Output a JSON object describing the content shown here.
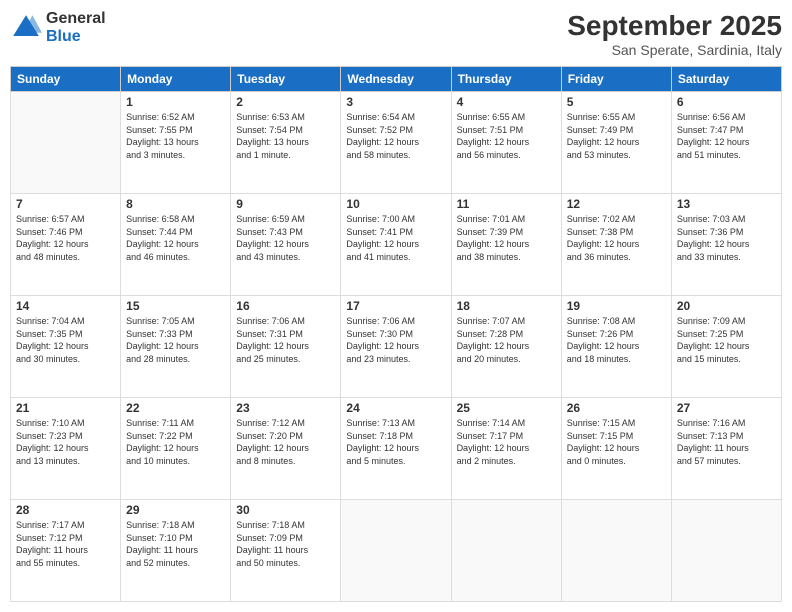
{
  "header": {
    "logo_general": "General",
    "logo_blue": "Blue",
    "month_title": "September 2025",
    "location": "San Sperate, Sardinia, Italy"
  },
  "days_of_week": [
    "Sunday",
    "Monday",
    "Tuesday",
    "Wednesday",
    "Thursday",
    "Friday",
    "Saturday"
  ],
  "weeks": [
    [
      {
        "day": "",
        "info": ""
      },
      {
        "day": "1",
        "info": "Sunrise: 6:52 AM\nSunset: 7:55 PM\nDaylight: 13 hours\nand 3 minutes."
      },
      {
        "day": "2",
        "info": "Sunrise: 6:53 AM\nSunset: 7:54 PM\nDaylight: 13 hours\nand 1 minute."
      },
      {
        "day": "3",
        "info": "Sunrise: 6:54 AM\nSunset: 7:52 PM\nDaylight: 12 hours\nand 58 minutes."
      },
      {
        "day": "4",
        "info": "Sunrise: 6:55 AM\nSunset: 7:51 PM\nDaylight: 12 hours\nand 56 minutes."
      },
      {
        "day": "5",
        "info": "Sunrise: 6:55 AM\nSunset: 7:49 PM\nDaylight: 12 hours\nand 53 minutes."
      },
      {
        "day": "6",
        "info": "Sunrise: 6:56 AM\nSunset: 7:47 PM\nDaylight: 12 hours\nand 51 minutes."
      }
    ],
    [
      {
        "day": "7",
        "info": "Sunrise: 6:57 AM\nSunset: 7:46 PM\nDaylight: 12 hours\nand 48 minutes."
      },
      {
        "day": "8",
        "info": "Sunrise: 6:58 AM\nSunset: 7:44 PM\nDaylight: 12 hours\nand 46 minutes."
      },
      {
        "day": "9",
        "info": "Sunrise: 6:59 AM\nSunset: 7:43 PM\nDaylight: 12 hours\nand 43 minutes."
      },
      {
        "day": "10",
        "info": "Sunrise: 7:00 AM\nSunset: 7:41 PM\nDaylight: 12 hours\nand 41 minutes."
      },
      {
        "day": "11",
        "info": "Sunrise: 7:01 AM\nSunset: 7:39 PM\nDaylight: 12 hours\nand 38 minutes."
      },
      {
        "day": "12",
        "info": "Sunrise: 7:02 AM\nSunset: 7:38 PM\nDaylight: 12 hours\nand 36 minutes."
      },
      {
        "day": "13",
        "info": "Sunrise: 7:03 AM\nSunset: 7:36 PM\nDaylight: 12 hours\nand 33 minutes."
      }
    ],
    [
      {
        "day": "14",
        "info": "Sunrise: 7:04 AM\nSunset: 7:35 PM\nDaylight: 12 hours\nand 30 minutes."
      },
      {
        "day": "15",
        "info": "Sunrise: 7:05 AM\nSunset: 7:33 PM\nDaylight: 12 hours\nand 28 minutes."
      },
      {
        "day": "16",
        "info": "Sunrise: 7:06 AM\nSunset: 7:31 PM\nDaylight: 12 hours\nand 25 minutes."
      },
      {
        "day": "17",
        "info": "Sunrise: 7:06 AM\nSunset: 7:30 PM\nDaylight: 12 hours\nand 23 minutes."
      },
      {
        "day": "18",
        "info": "Sunrise: 7:07 AM\nSunset: 7:28 PM\nDaylight: 12 hours\nand 20 minutes."
      },
      {
        "day": "19",
        "info": "Sunrise: 7:08 AM\nSunset: 7:26 PM\nDaylight: 12 hours\nand 18 minutes."
      },
      {
        "day": "20",
        "info": "Sunrise: 7:09 AM\nSunset: 7:25 PM\nDaylight: 12 hours\nand 15 minutes."
      }
    ],
    [
      {
        "day": "21",
        "info": "Sunrise: 7:10 AM\nSunset: 7:23 PM\nDaylight: 12 hours\nand 13 minutes."
      },
      {
        "day": "22",
        "info": "Sunrise: 7:11 AM\nSunset: 7:22 PM\nDaylight: 12 hours\nand 10 minutes."
      },
      {
        "day": "23",
        "info": "Sunrise: 7:12 AM\nSunset: 7:20 PM\nDaylight: 12 hours\nand 8 minutes."
      },
      {
        "day": "24",
        "info": "Sunrise: 7:13 AM\nSunset: 7:18 PM\nDaylight: 12 hours\nand 5 minutes."
      },
      {
        "day": "25",
        "info": "Sunrise: 7:14 AM\nSunset: 7:17 PM\nDaylight: 12 hours\nand 2 minutes."
      },
      {
        "day": "26",
        "info": "Sunrise: 7:15 AM\nSunset: 7:15 PM\nDaylight: 12 hours\nand 0 minutes."
      },
      {
        "day": "27",
        "info": "Sunrise: 7:16 AM\nSunset: 7:13 PM\nDaylight: 11 hours\nand 57 minutes."
      }
    ],
    [
      {
        "day": "28",
        "info": "Sunrise: 7:17 AM\nSunset: 7:12 PM\nDaylight: 11 hours\nand 55 minutes."
      },
      {
        "day": "29",
        "info": "Sunrise: 7:18 AM\nSunset: 7:10 PM\nDaylight: 11 hours\nand 52 minutes."
      },
      {
        "day": "30",
        "info": "Sunrise: 7:18 AM\nSunset: 7:09 PM\nDaylight: 11 hours\nand 50 minutes."
      },
      {
        "day": "",
        "info": ""
      },
      {
        "day": "",
        "info": ""
      },
      {
        "day": "",
        "info": ""
      },
      {
        "day": "",
        "info": ""
      }
    ]
  ]
}
